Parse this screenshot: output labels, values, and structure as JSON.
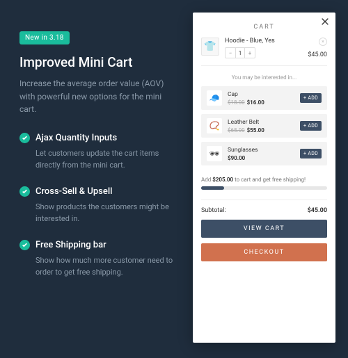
{
  "promo": {
    "badge": "New in 3.18",
    "title": "Improved Mini Cart",
    "desc": "Increase the average order value (AOV) with powerful new options for the mini cart.",
    "features": [
      {
        "title": "Ajax Quantity Inputs",
        "desc": "Let customers update the cart items directly from the mini cart."
      },
      {
        "title": "Cross-Sell & Upsell",
        "desc": "Show products the customers might be interested in."
      },
      {
        "title": "Free Shipping bar",
        "desc": "Show how much more customer need to order to get free shipping."
      }
    ]
  },
  "cart": {
    "title": "CART",
    "item": {
      "name": "Hoodie - Blue, Yes",
      "qty": "1",
      "price": "$45.00",
      "emoji": "👕"
    },
    "interest_header": "You may be interested in...",
    "suggestions": [
      {
        "name": "Cap",
        "old": "$18.00",
        "price": "$16.00",
        "emoji": "🧢"
      },
      {
        "name": "Leather Belt",
        "old": "$65.00",
        "price": "$55.00",
        "emoji": "📿"
      },
      {
        "name": "Sunglasses",
        "old": "",
        "price": "$90.00",
        "emoji": "🕶"
      }
    ],
    "add_label": "+ ADD",
    "ship_prefix": "Add ",
    "ship_amount": "$205.00",
    "ship_suffix": " to cart and get free shipping!",
    "subtotal_label": "Subtotal:",
    "subtotal_value": "$45.00",
    "view_label": "VIEW CART",
    "checkout_label": "CHECKOUT"
  },
  "colors": {
    "accent": "#1abc9c",
    "primary": "#3d4f66",
    "checkout": "#d1714e"
  }
}
